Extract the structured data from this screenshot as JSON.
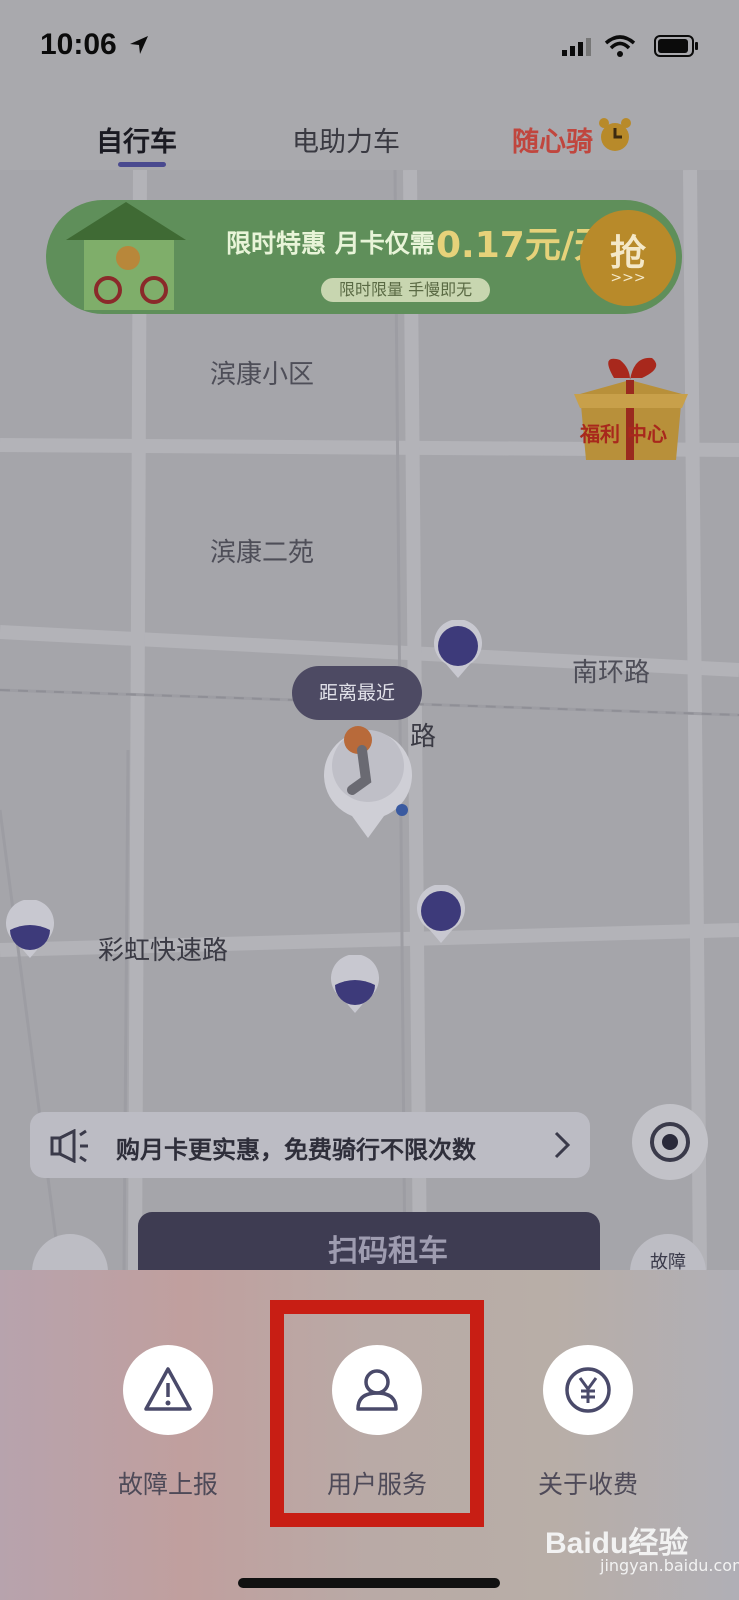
{
  "status_bar": {
    "time": "10:06"
  },
  "tabs": [
    {
      "label": "自行车",
      "active": true
    },
    {
      "label": "电助力车",
      "active": false
    },
    {
      "label": "随心骑",
      "active": false
    }
  ],
  "banner": {
    "headline": "限时特惠 月卡仅需",
    "price": "0.17元/天",
    "subtext": "限时限量 手慢即无",
    "grab_label": "抢",
    "grab_arrows": ">>>"
  },
  "gift": {
    "label": "福利 中心"
  },
  "map": {
    "labels": [
      "滨康小区",
      "滨康二苑",
      "南环路",
      "彩虹快速路"
    ],
    "road_vertical": "路"
  },
  "nearest_tag": "距离最近",
  "notice": {
    "text": "购月卡更实惠，免费骑行不限次数"
  },
  "scan": {
    "label": "扫码租车"
  },
  "fault_mini": {
    "label": "故障"
  },
  "actions": [
    {
      "label": "故障上报",
      "icon": "warning-icon"
    },
    {
      "label": "用户服务",
      "icon": "user-icon"
    },
    {
      "label": "关于收费",
      "icon": "yen-icon"
    }
  ],
  "watermark": {
    "brand": "Baidu经验",
    "url": "jingyan.baidu.com"
  },
  "colors": {
    "accent": "#4a4a8f",
    "highlight": "#c81e14",
    "banner_green": "#5f8f5a"
  }
}
